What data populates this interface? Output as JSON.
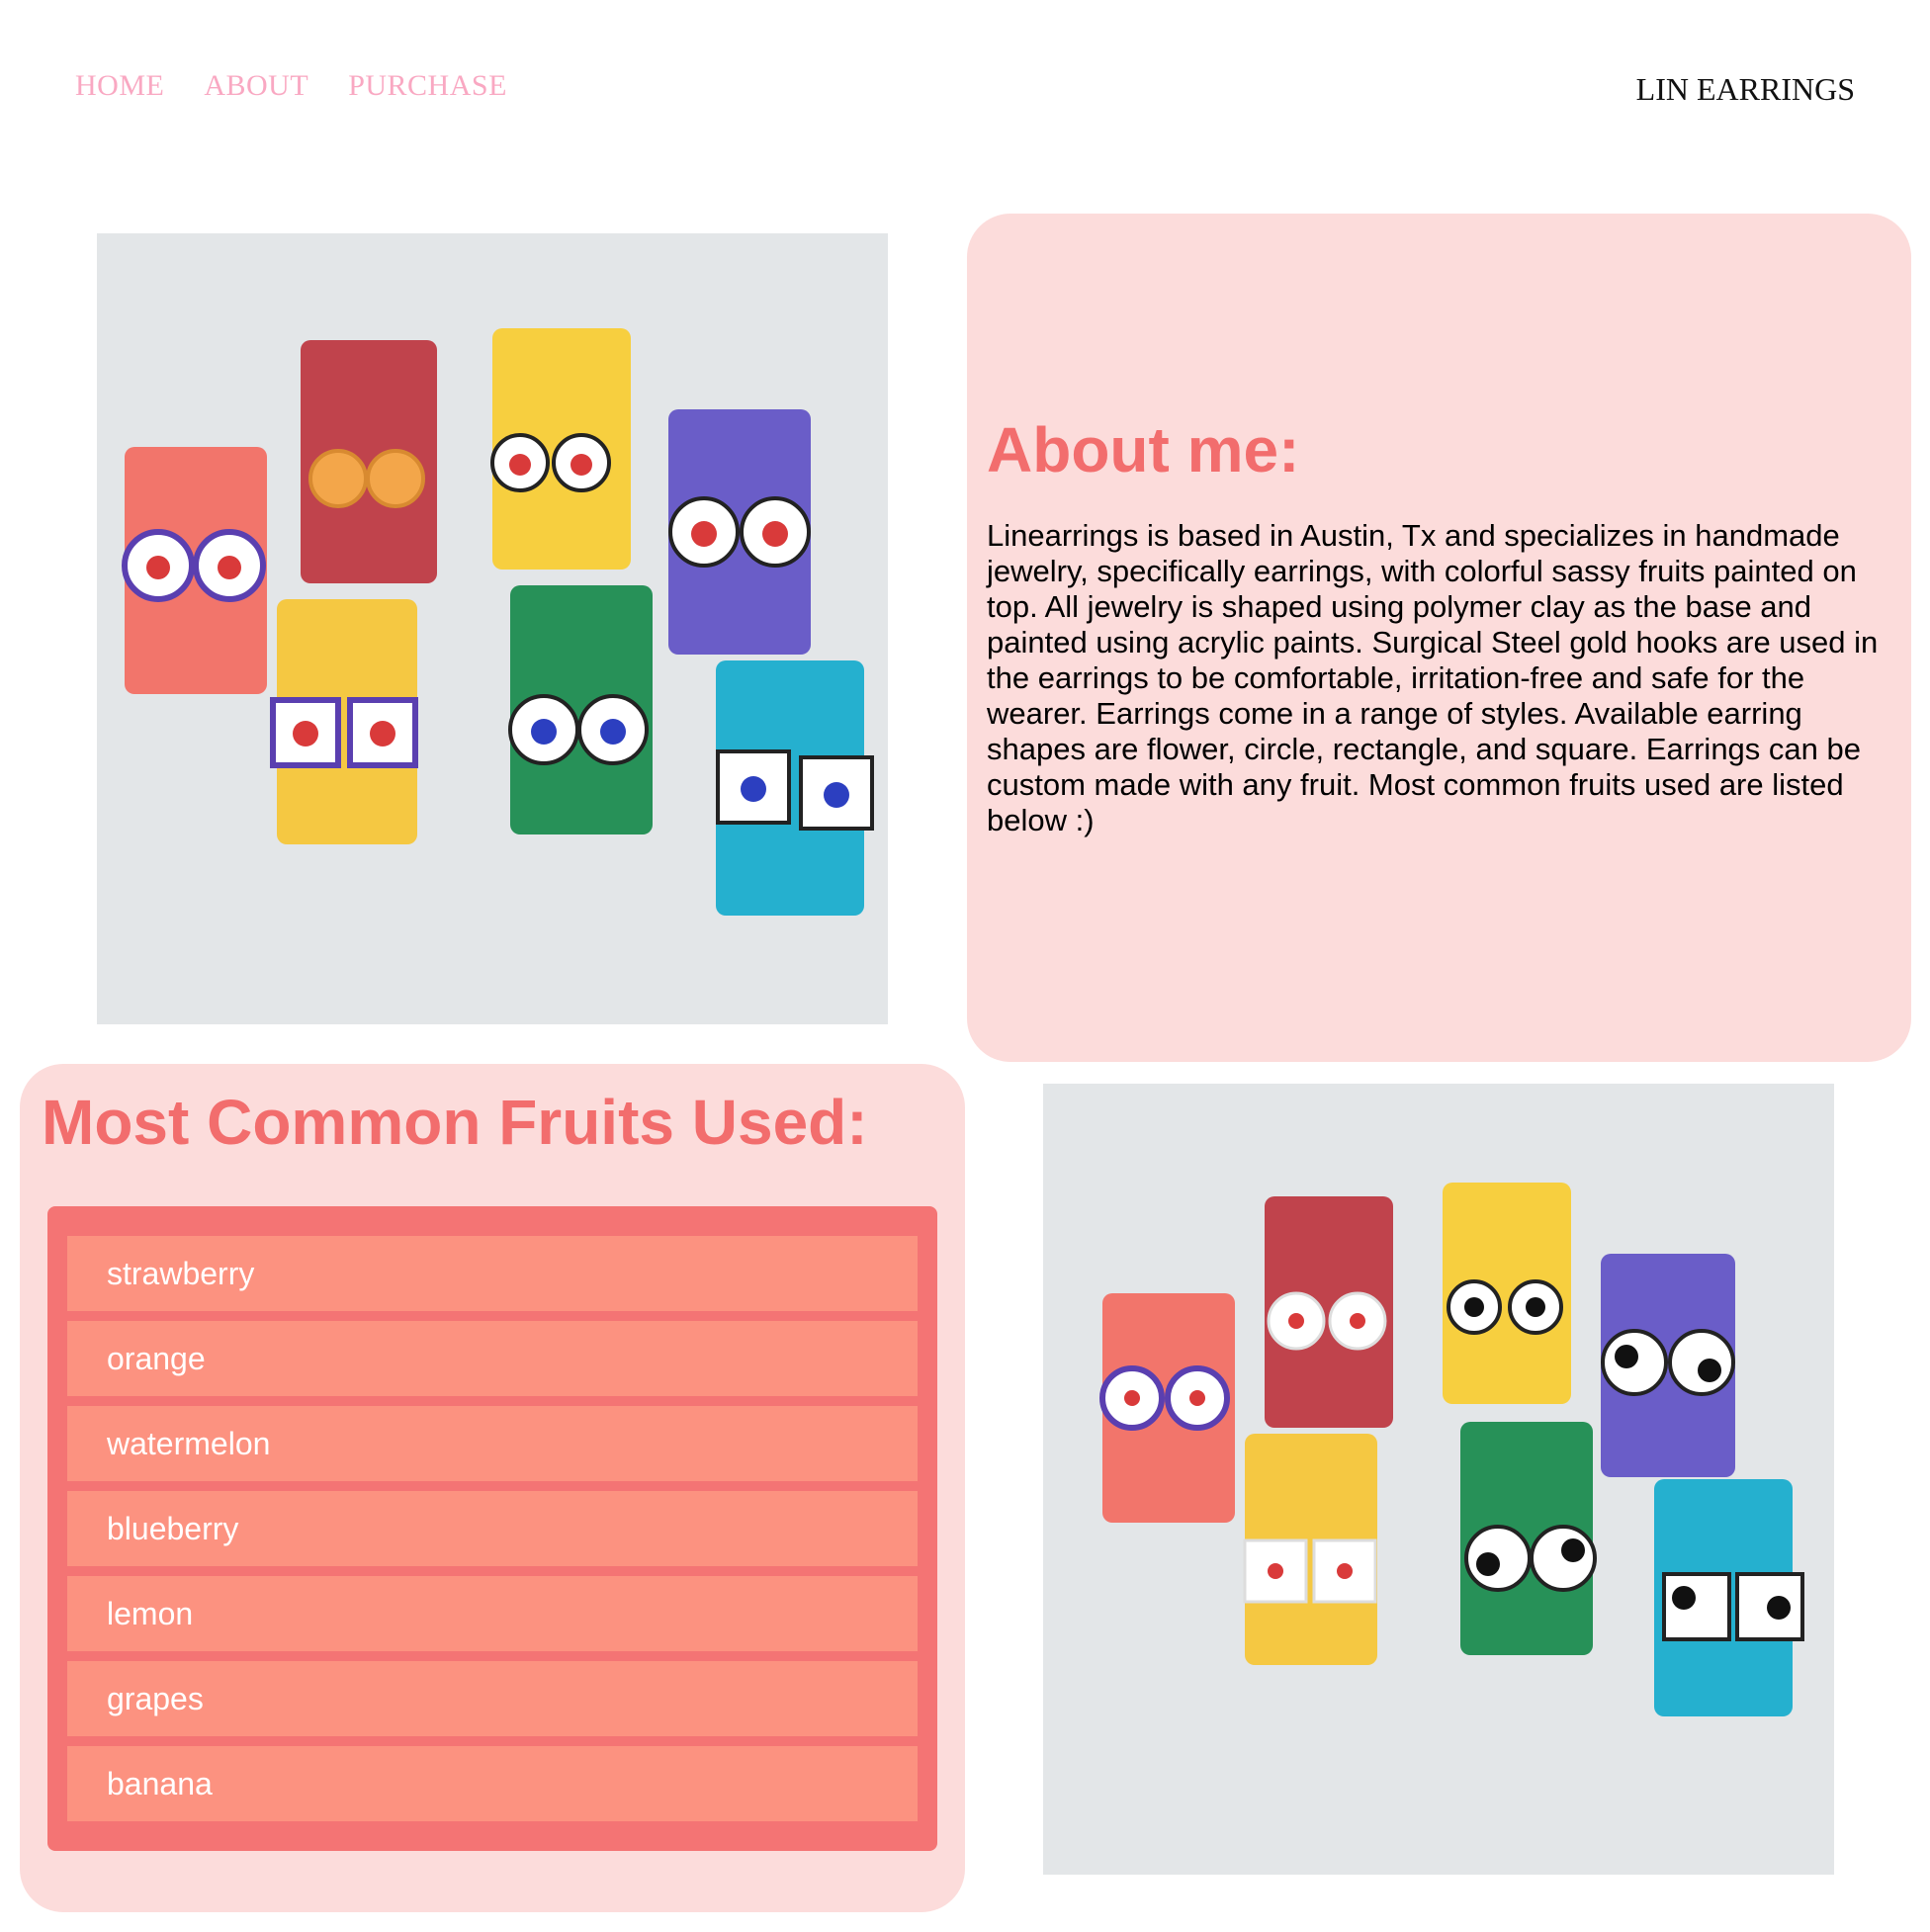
{
  "nav": {
    "home": "HOME",
    "about": "ABOUT",
    "purchase": "PURCHASE"
  },
  "brand": "LIN EARRINGS",
  "about": {
    "title": "About me:",
    "text": "Linearrings is based in Austin, Tx and specializes in handmade jewelry, specifically earrings, with colorful sassy fruits painted on top. All jewelry is shaped using polymer clay as the base and painted using acrylic paints. Surgical Steel gold hooks are used in the earrings to be comfortable, irritation-free and safe for the wearer. Earrings come in a range of styles. Available earring shapes are flower, circle, rectangle, and square. Earrings can be custom made with any fruit. Most common fruits used are listed below :)"
  },
  "fruits": {
    "title": "Most Common Fruits Used:",
    "items": [
      "strawberry",
      "orange",
      "watermelon",
      "blueberry",
      "lemon",
      "grapes",
      "banana"
    ]
  },
  "colors": {
    "nav_link": "#f9a8c2",
    "card_bg": "#fcdcdb",
    "heading": "#f26d6d",
    "list_bg": "#f47474",
    "list_item": "#fc9280"
  },
  "images": {
    "photo1": "earrings-display-photo-character-fruits",
    "photo2": "earrings-display-photo-cow-print"
  }
}
